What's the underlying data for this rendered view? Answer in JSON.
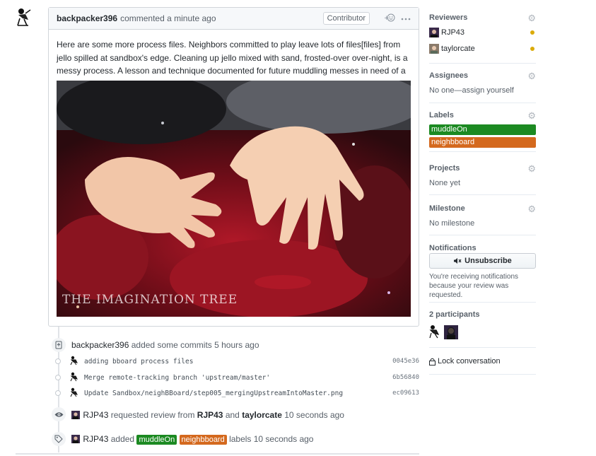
{
  "comment": {
    "author": "backpacker396",
    "action": "commented a minute ago",
    "role_badge": "Contributor",
    "reaction_icon": "smiley-icon",
    "menu_icon": "kebab-horizontal-icon",
    "body": "Here are some more process files. Neighbors committed to play leave lots of files[files] from jello spilled at sandbox's edge. Cleaning up jello mixed with sand, frosted-over over-night, is a messy process. A lesson and technique documented for future muddling messes in need of a mother's helping hand to redd-up.",
    "image_credit": "THE IMAGINATION TREE"
  },
  "timeline": {
    "commits_event": {
      "author": "backpacker396",
      "text": "added some commits 5 hours ago"
    },
    "commits": [
      {
        "message": "adding bboard process files",
        "sha": "0045e36"
      },
      {
        "message": "Merge remote-tracking branch 'upstream/master'",
        "sha": "6b56840"
      },
      {
        "message": "Update Sandbox/neighBBoard/step005_mergingUpstreamIntoMaster.png",
        "sha": "ec09613"
      }
    ],
    "review_event": {
      "actor": "RJP43",
      "text1": "requested review from",
      "reviewer1": "RJP43",
      "and": "and",
      "reviewer2": "taylorcate",
      "time": "10 seconds ago"
    },
    "label_event": {
      "actor": "RJP43",
      "text": "added",
      "label1": "muddleOn",
      "label2": "neighbboard",
      "suffix": "labels 10 seconds ago"
    }
  },
  "sidebar": {
    "reviewers": {
      "title": "Reviewers",
      "items": [
        {
          "name": "RJP43",
          "status_color": "#dbab09"
        },
        {
          "name": "taylorcate",
          "status_color": "#dbab09"
        }
      ]
    },
    "assignees": {
      "title": "Assignees",
      "value": "No one—assign yourself"
    },
    "labels": {
      "title": "Labels",
      "items": [
        {
          "name": "muddleOn",
          "color": "#1c8a22"
        },
        {
          "name": "neighbboard",
          "color": "#d4691e"
        }
      ]
    },
    "projects": {
      "title": "Projects",
      "value": "None yet"
    },
    "milestone": {
      "title": "Milestone",
      "value": "No milestone"
    },
    "notifications": {
      "title": "Notifications",
      "button": "Unsubscribe",
      "button_icon": "mute-icon",
      "text": "You're receiving notifications because your review was requested."
    },
    "participants": {
      "title": "2 participants"
    },
    "lock": {
      "label": "Lock conversation",
      "icon": "lock-icon"
    }
  },
  "colors": {
    "label_green": "#1c8a22",
    "label_orange": "#d4691e",
    "pending_dot": "#dbab09"
  }
}
